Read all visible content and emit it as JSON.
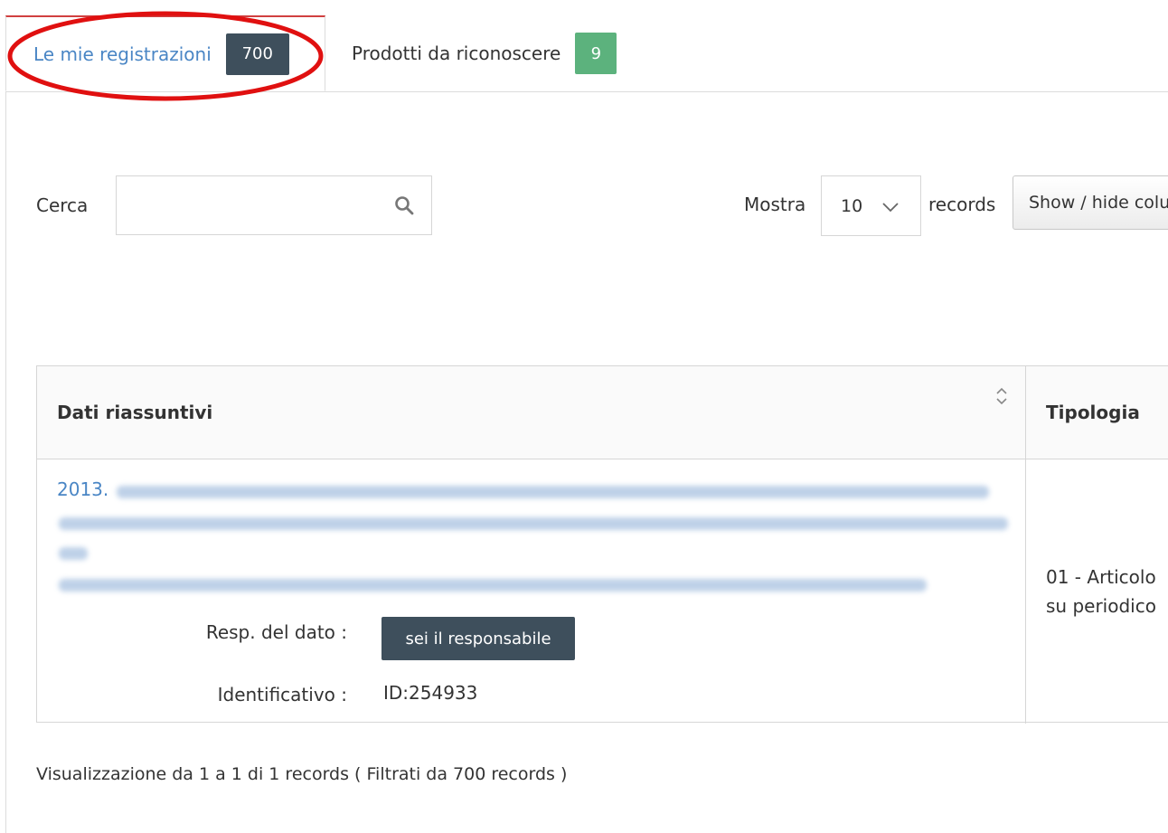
{
  "tabs": [
    {
      "label": "Le mie registrazioni",
      "count": "700"
    },
    {
      "label": "Prodotti da riconoscere",
      "count": "9"
    }
  ],
  "search": {
    "label": "Cerca",
    "value": "",
    "placeholder": ""
  },
  "length_menu": {
    "prefix": "Mostra",
    "selected": "10",
    "suffix": "records"
  },
  "colvis": {
    "label": "Show / hide columns"
  },
  "table": {
    "headers": [
      "Dati riassuntivi",
      "Tipologia"
    ],
    "rows": [
      {
        "year": "2013.",
        "resp_label": "Resp. del dato :",
        "resp_button": "sei il responsabile",
        "id_label": "Identificativo :",
        "id_value": "ID:254933",
        "tipologia": "01 - Articolo su periodico"
      }
    ]
  },
  "info": "Visualizzazione da 1 a 1 di 1 records ( Filtrati da 700 records )",
  "colors": {
    "link": "#4a86c5",
    "dark_badge": "#3e4f5c",
    "green_badge": "#5cb27d",
    "annotation": "#e01010"
  }
}
